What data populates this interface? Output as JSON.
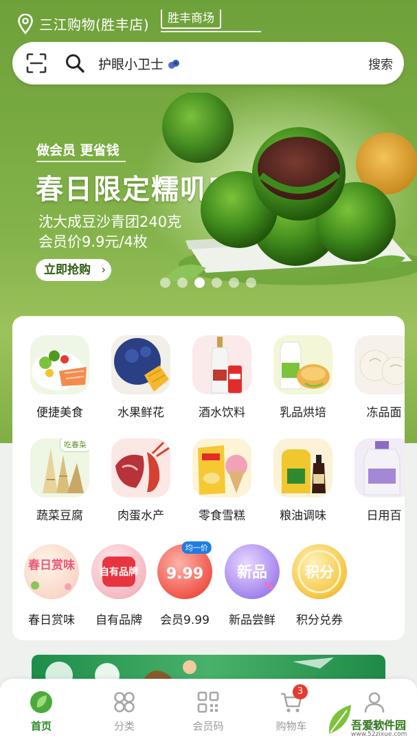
{
  "header": {
    "store_name": "三江购物(胜丰店)",
    "mall_tag": "胜丰商场"
  },
  "search": {
    "query": "护眼小卫士",
    "button_label": "搜索"
  },
  "banner": {
    "tag": "做会员 更省钱",
    "title": "春日限定糯叽叽",
    "subtitle_1": "沈大成豆沙青团240克",
    "subtitle_2": "会员价9.9元/4枚",
    "cta": "立即抢购",
    "cta_chevron": "›",
    "dots_total": 6,
    "dots_active_index": 2
  },
  "categories": {
    "row1": [
      {
        "label": "便捷美食",
        "icon": "salad-salmon-icon"
      },
      {
        "label": "水果鲜花",
        "icon": "blueberry-mango-icon"
      },
      {
        "label": "酒水饮料",
        "icon": "liquor-cola-icon"
      },
      {
        "label": "乳品烘培",
        "icon": "milk-bread-icon"
      },
      {
        "label": "冻品面",
        "icon": "dumpling-icon"
      }
    ],
    "row2": [
      {
        "label": "蔬菜豆腐",
        "icon": "bamboo-shoot-icon",
        "badge": "吃春菜"
      },
      {
        "label": "肉蛋水产",
        "icon": "meat-lobster-icon"
      },
      {
        "label": "零食雪糕",
        "icon": "chips-icecream-icon"
      },
      {
        "label": "粮油调味",
        "icon": "oil-sauce-icon"
      },
      {
        "label": "日用百",
        "icon": "detergent-icon"
      }
    ],
    "row3": [
      {
        "label": "春日赏味",
        "icon": "spring-taste-icon",
        "art_text": "春日赏味"
      },
      {
        "label": "自有品牌",
        "icon": "own-brand-icon",
        "art_text": "自有品牌"
      },
      {
        "label": "会员9.99",
        "icon": "member-999-icon",
        "art_text": "9.99",
        "pill": "均一价"
      },
      {
        "label": "新品尝鲜",
        "icon": "new-product-icon",
        "art_text": "新品"
      },
      {
        "label": "积分兑券",
        "icon": "points-coupon-icon",
        "art_text": "积分"
      }
    ]
  },
  "tabbar": {
    "tabs": [
      {
        "label": "首页",
        "icon": "home-icon",
        "active": true
      },
      {
        "label": "分类",
        "icon": "category-icon",
        "active": false
      },
      {
        "label": "会员码",
        "icon": "member-code-icon",
        "active": false
      },
      {
        "label": "购物车",
        "icon": "cart-icon",
        "active": false,
        "badge": "3"
      },
      {
        "label": "我的",
        "icon": "profile-icon",
        "active": false
      }
    ]
  },
  "watermark": {
    "text": "吾爱软件园",
    "url": "www.52zixue.com"
  },
  "colors": {
    "brand_green": "#6fa13a",
    "active_tab": "#2f8a2a",
    "cart_badge": "#e83a2e"
  }
}
